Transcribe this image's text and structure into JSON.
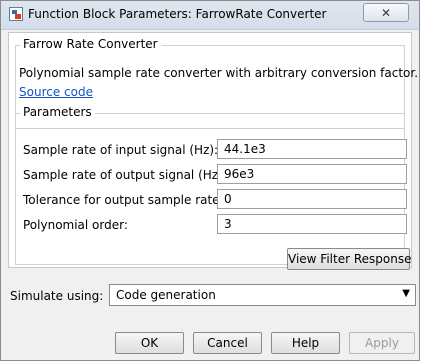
{
  "window": {
    "title": "Function Block Parameters: FarrowRate Converter",
    "close_glyph": "✕"
  },
  "block": {
    "group_title": "Farrow Rate Converter",
    "description": "Polynomial sample rate converter with arbitrary conversion factor.",
    "source_link": "Source code"
  },
  "parameters": {
    "group_title": "Parameters",
    "fields": [
      {
        "label": "Sample rate of input signal (Hz):",
        "value": "44.1e3"
      },
      {
        "label": "Sample rate of output signal (Hz):",
        "value": "96e3"
      },
      {
        "label": "Tolerance for output sample rate:",
        "value": "0"
      },
      {
        "label": "Polynomial order:",
        "value": "3"
      }
    ],
    "view_filter_response_label": "View Filter Response"
  },
  "simulate": {
    "label": "Simulate using:",
    "selected": "Code generation"
  },
  "footer": {
    "ok_label": "OK",
    "cancel_label": "Cancel",
    "help_label": "Help",
    "apply_label": "Apply"
  }
}
